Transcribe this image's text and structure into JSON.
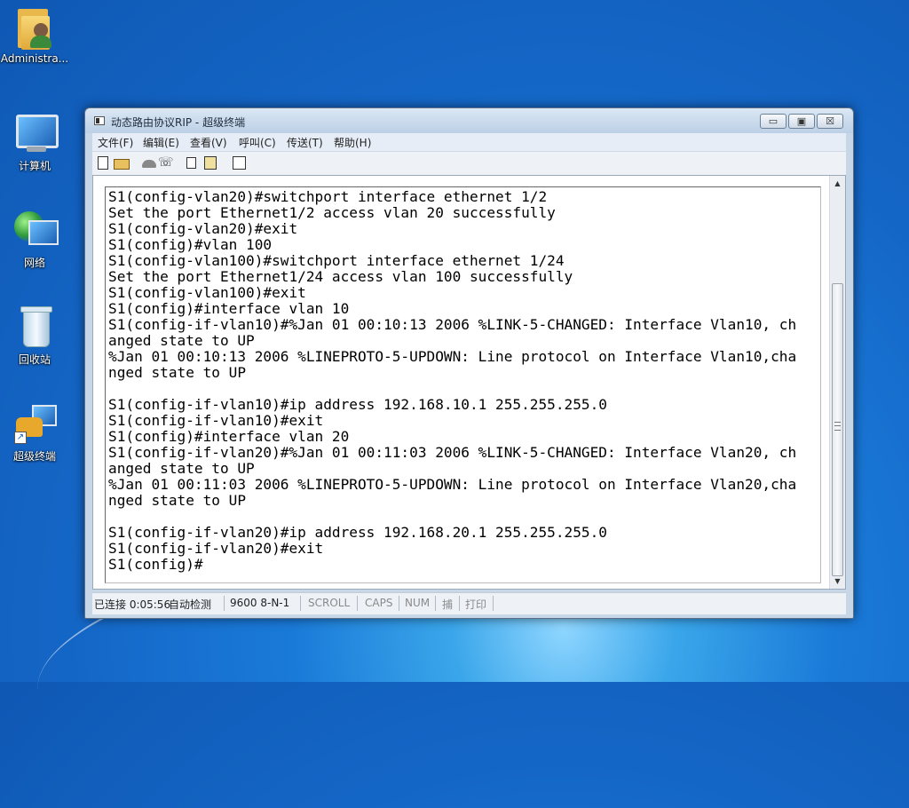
{
  "desktop": {
    "icons": [
      {
        "label": "Administra...",
        "icon": "user-folder-icon"
      },
      {
        "label": "计算机",
        "icon": "computer-icon"
      },
      {
        "label": "网络",
        "icon": "network-icon"
      },
      {
        "label": "回收站",
        "icon": "recycle-bin-icon"
      },
      {
        "label": "超级终端",
        "icon": "hyperterminal-icon"
      }
    ]
  },
  "window": {
    "title": "动态路由协议RIP - 超级终端",
    "controls": {
      "minimize": "▭",
      "maximize": "▣",
      "close": "☒"
    },
    "menu": [
      "文件(F)",
      "编辑(E)",
      "查看(V)",
      "呼叫(C)",
      "传送(T)",
      "帮助(H)"
    ],
    "terminal_lines": [
      "S1(config-vlan20)#switchport interface ethernet 1/2",
      "Set the port Ethernet1/2 access vlan 20 successfully",
      "S1(config-vlan20)#exit",
      "S1(config)#vlan 100",
      "S1(config-vlan100)#switchport interface ethernet 1/24",
      "Set the port Ethernet1/24 access vlan 100 successfully",
      "S1(config-vlan100)#exit",
      "S1(config)#interface vlan 10",
      "S1(config-if-vlan10)#%Jan 01 00:10:13 2006 %LINK-5-CHANGED: Interface Vlan10, ch",
      "anged state to UP",
      "%Jan 01 00:10:13 2006 %LINEPROTO-5-UPDOWN: Line protocol on Interface Vlan10,cha",
      "nged state to UP",
      "",
      "S1(config-if-vlan10)#ip address 192.168.10.1 255.255.255.0",
      "S1(config-if-vlan10)#exit",
      "S1(config)#interface vlan 20",
      "S1(config-if-vlan20)#%Jan 01 00:11:03 2006 %LINK-5-CHANGED: Interface Vlan20, ch",
      "anged state to UP",
      "%Jan 01 00:11:03 2006 %LINEPROTO-5-UPDOWN: Line protocol on Interface Vlan20,cha",
      "nged state to UP",
      "",
      "S1(config-if-vlan20)#ip address 192.168.20.1 255.255.255.0",
      "S1(config-if-vlan20)#exit",
      "S1(config)#"
    ],
    "status": {
      "connection": "已连接 0:05:56",
      "detect": "自动检测",
      "port_settings": "9600 8-N-1",
      "scroll": "SCROLL",
      "caps": "CAPS",
      "num": "NUM",
      "capture": "捕",
      "print": "打印"
    }
  }
}
